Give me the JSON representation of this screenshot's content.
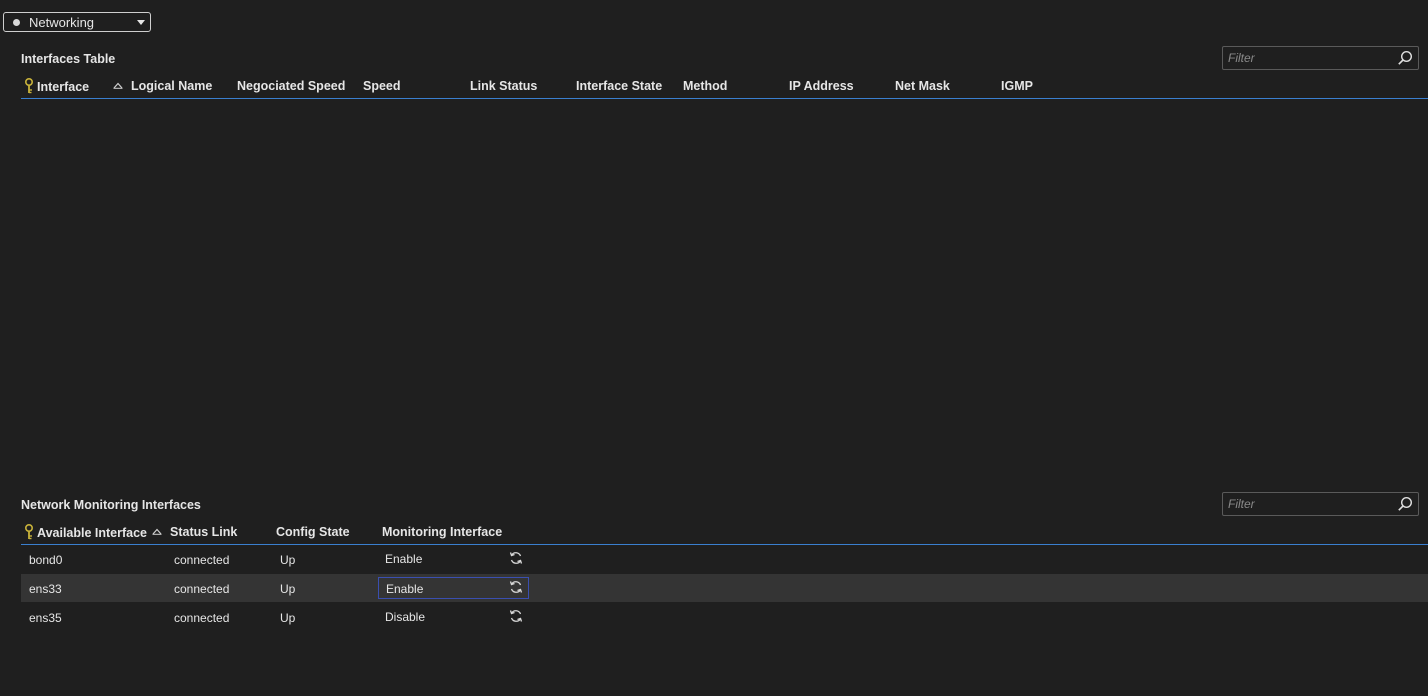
{
  "dropdown": {
    "label": "Networking"
  },
  "interfaces_table": {
    "title": "Interfaces Table",
    "filter_placeholder": "Filter",
    "columns": [
      "Interface",
      "Logical Name",
      "Negociated Speed",
      "Speed",
      "Link Status",
      "Interface State",
      "Method",
      "IP Address",
      "Net Mask",
      "IGMP"
    ]
  },
  "monitoring_table": {
    "title": "Network Monitoring Interfaces",
    "filter_placeholder": "Filter",
    "columns": [
      "Available Interface",
      "Status Link",
      "Config State",
      "Monitoring Interface"
    ],
    "rows": [
      {
        "interface": "bond0",
        "status_link": "connected",
        "config_state": "Up",
        "monitoring": "Enable"
      },
      {
        "interface": "ens33",
        "status_link": "connected",
        "config_state": "Up",
        "monitoring": "Enable"
      },
      {
        "interface": "ens35",
        "status_link": "connected",
        "config_state": "Up",
        "monitoring": "Disable"
      }
    ]
  },
  "colors": {
    "background": "#1f1f1f",
    "header_underline": "#3a7fcf",
    "key_icon": "#c9b33a",
    "selected_row": "#343434"
  }
}
